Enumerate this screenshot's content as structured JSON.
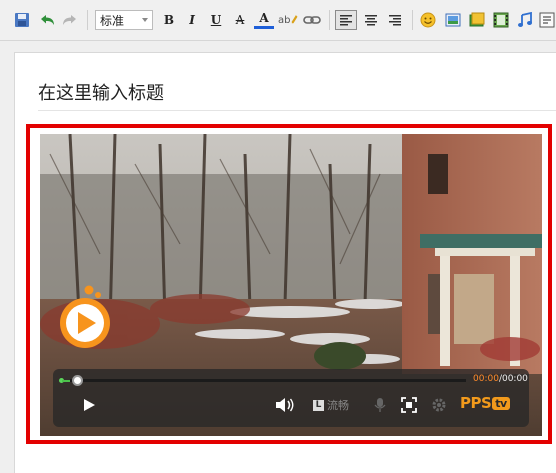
{
  "toolbar": {
    "font_style_value": "标准",
    "bold_label": "B",
    "italic_label": "I",
    "underline_label": "U",
    "strike_label": "A",
    "color_label": "A",
    "highlight_label": "ab",
    "icons": [
      "save-icon",
      "undo-icon",
      "redo-icon",
      "bold-icon",
      "italic-icon",
      "underline-icon",
      "strikethrough-icon",
      "font-color-icon",
      "highlight-icon",
      "link-icon",
      "align-left-icon",
      "align-center-icon",
      "align-right-icon",
      "emoticon-icon",
      "image-icon",
      "gallery-icon",
      "video-icon",
      "music-icon",
      "more-icon"
    ]
  },
  "editor": {
    "title": "在这里输入标题"
  },
  "video": {
    "time_current": "00:00",
    "time_total": "/00:00",
    "quality_label": "流畅",
    "quality_box": "L",
    "brand": "PPS",
    "brand_suffix": "tv",
    "progress": 0
  },
  "colors": {
    "frame_border": "#e30000",
    "brand": "#f29a1c",
    "progress_green": "#4bc24b"
  }
}
